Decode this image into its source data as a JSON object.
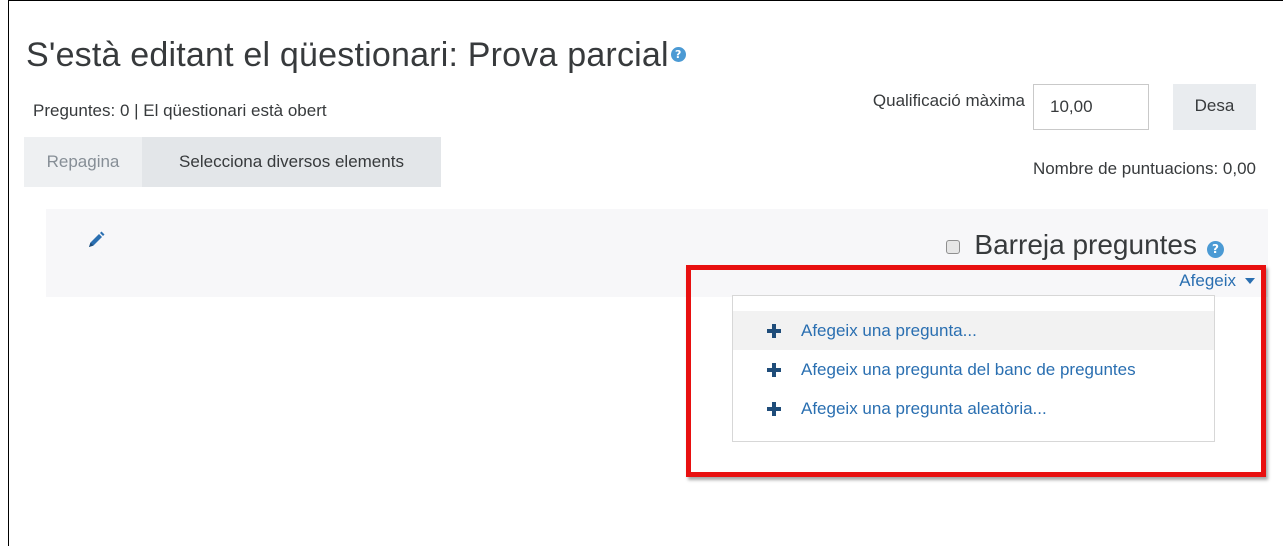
{
  "page": {
    "title": "S'està editant el qüestionari: Prova parcial",
    "status": "Preguntes: 0 | El qüestionari està obert"
  },
  "maxgrade": {
    "label": "Qualificació màxima",
    "value": "10,00",
    "save_label": "Desa"
  },
  "toolbar": {
    "repaginate_label": "Repagina",
    "select_multiple_label": "Selecciona diversos elements"
  },
  "total_marks": "Nombre de puntuacions: 0,00",
  "section": {
    "shuffle_label": "Barreja preguntes",
    "shuffle_checked": false
  },
  "add_menu": {
    "toggle_label": "Afegeix",
    "items": [
      {
        "label": "Afegeix una pregunta..."
      },
      {
        "label": "Afegeix una pregunta del banc de preguntes"
      },
      {
        "label": "Afegeix una pregunta aleatòria..."
      }
    ]
  },
  "icons": {
    "help": "help-icon",
    "edit": "pencil-icon",
    "add": "plus-icon",
    "dropdown": "caret-down-icon"
  },
  "colors": {
    "link": "#2a6fb1",
    "help_icon": "#4b9ad4",
    "highlight_border": "#e81010",
    "section_background": "#f7f7f9",
    "button_background": "#e9ecef"
  }
}
